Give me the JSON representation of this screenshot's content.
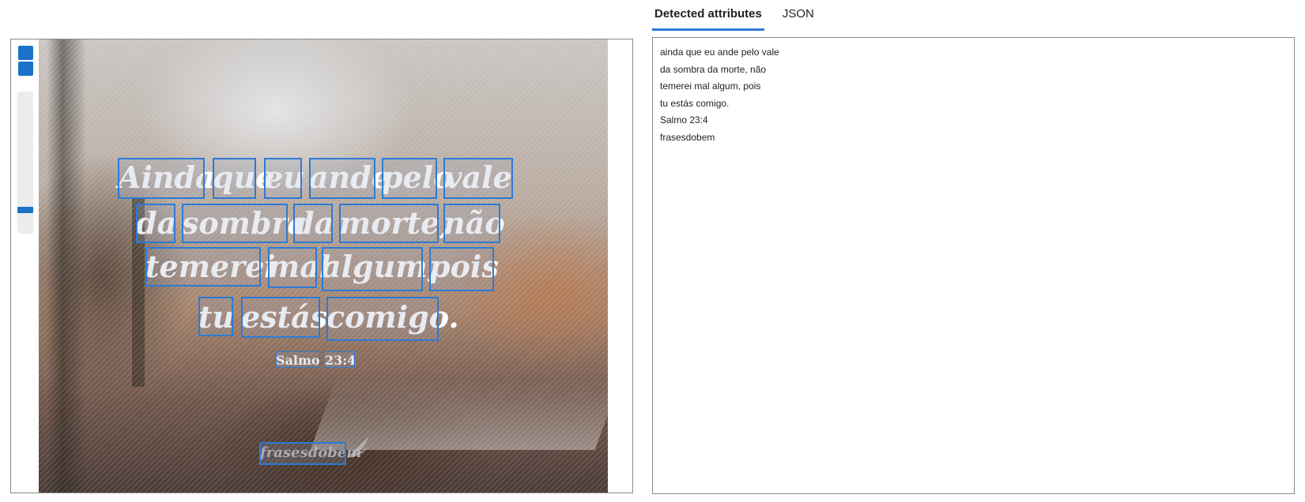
{
  "tabs": [
    {
      "label": "Detected attributes",
      "active": true
    },
    {
      "label": "JSON",
      "active": false
    }
  ],
  "zoom": {
    "level": 0.15
  },
  "image_words": [
    {
      "text": "Ainda"
    },
    {
      "text": "que"
    },
    {
      "text": "eu"
    },
    {
      "text": "ande"
    },
    {
      "text": "pelo"
    },
    {
      "text": "vale"
    },
    {
      "text": "da"
    },
    {
      "text": "sombra"
    },
    {
      "text": "da"
    },
    {
      "text": "morte,"
    },
    {
      "text": "não"
    },
    {
      "text": "temerei"
    },
    {
      "text": "mal"
    },
    {
      "text": "algum,"
    },
    {
      "text": "pois"
    },
    {
      "text": "tu"
    },
    {
      "text": "estás"
    },
    {
      "text": "comigo."
    },
    {
      "text": "Salmo"
    },
    {
      "text": "23:4"
    },
    {
      "text": "frasesdobem"
    }
  ],
  "detected_lines": [
    "ainda que eu ande pelo vale",
    "da sombra da morte, não",
    "temerei mal algum, pois",
    "tu estás comigo.",
    "Salmo 23:4",
    "frasesdobem"
  ],
  "colors": {
    "accent": "#2b7bd6",
    "panel_border": "#8a8a8a"
  }
}
